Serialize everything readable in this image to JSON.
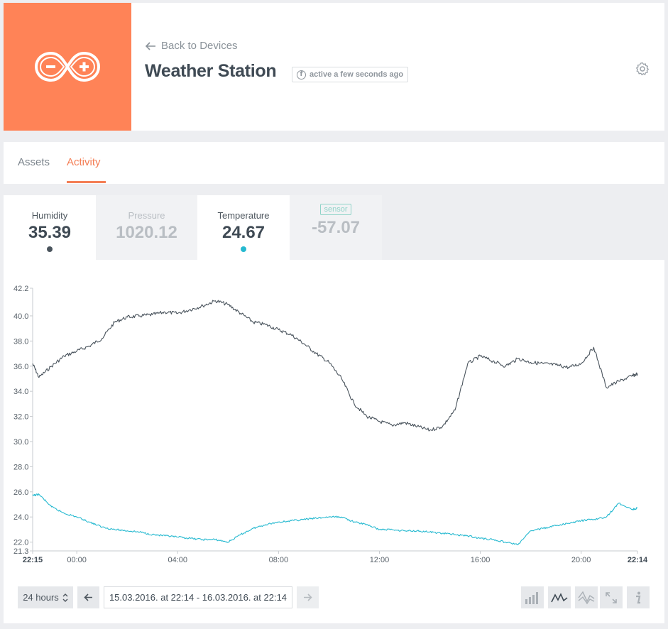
{
  "header": {
    "logo_icon": "arduino-infinity-icon",
    "logo_bg": "#ff8357",
    "back_label": "Back to Devices",
    "title": "Weather Station",
    "status": "active a few seconds ago",
    "status_icon": "f"
  },
  "tabs": [
    {
      "label": "Assets",
      "active": false
    },
    {
      "label": "Activity",
      "active": true
    }
  ],
  "accent": "#f47e55",
  "metrics": [
    {
      "label": "Humidity",
      "value": "35.39",
      "selected": true,
      "color": "#4a545d"
    },
    {
      "label": "Pressure",
      "value": "1020.12",
      "selected": false
    },
    {
      "label": "Temperature",
      "value": "24.67",
      "selected": true,
      "color": "#26b9d0"
    },
    {
      "label": "sensor",
      "value": "-57.07",
      "selected": false
    }
  ],
  "chart_data": {
    "type": "line",
    "y_ticks": [
      "42.2",
      "40.0",
      "38.0",
      "36.0",
      "34.0",
      "32.0",
      "30.0",
      "28.0",
      "26.0",
      "24.0",
      "22.0",
      "21.3"
    ],
    "ylim": [
      21.3,
      42.2
    ],
    "x_ticks": [
      "22:15",
      "00:00",
      "04:00",
      "08:00",
      "12:00",
      "16:00",
      "20:00",
      "22:14"
    ],
    "grid": false,
    "series": [
      {
        "name": "Humidity",
        "color": "#4a545d",
        "x": [
          "22:15",
          "22:30",
          "23:00",
          "23:30",
          "00:00",
          "00:30",
          "01:00",
          "01:30",
          "02:00",
          "02:30",
          "03:00",
          "03:30",
          "04:00",
          "04:30",
          "05:00",
          "05:30",
          "06:00",
          "06:30",
          "07:00",
          "07:30",
          "08:00",
          "08:30",
          "09:00",
          "09:30",
          "10:00",
          "10:30",
          "11:00",
          "11:30",
          "12:00",
          "12:30",
          "13:00",
          "13:30",
          "14:00",
          "14:30",
          "15:00",
          "15:30",
          "16:00",
          "16:30",
          "17:00",
          "17:30",
          "18:00",
          "18:30",
          "19:00",
          "19:30",
          "20:00",
          "20:30",
          "21:00",
          "21:30",
          "22:00",
          "22:14"
        ],
        "values": [
          36.2,
          35.1,
          36.0,
          36.8,
          37.2,
          37.6,
          38.2,
          39.5,
          39.9,
          40.0,
          40.1,
          40.3,
          40.2,
          40.5,
          40.8,
          41.2,
          40.9,
          40.2,
          39.5,
          39.3,
          38.9,
          38.5,
          37.8,
          37.0,
          36.3,
          35.0,
          33.0,
          32.0,
          31.6,
          31.3,
          31.5,
          31.2,
          30.9,
          31.2,
          32.5,
          36.2,
          36.8,
          36.4,
          36.0,
          36.6,
          36.3,
          36.2,
          36.1,
          35.9,
          36.2,
          37.5,
          34.3,
          34.8,
          35.2,
          35.4
        ]
      },
      {
        "name": "Temperature",
        "color": "#26b9d0",
        "x": [
          "22:15",
          "22:30",
          "23:00",
          "23:30",
          "00:00",
          "00:30",
          "01:00",
          "01:30",
          "02:00",
          "02:30",
          "03:00",
          "03:30",
          "04:00",
          "04:30",
          "05:00",
          "05:30",
          "06:00",
          "06:30",
          "07:00",
          "07:30",
          "08:00",
          "08:30",
          "09:00",
          "09:30",
          "10:00",
          "10:30",
          "11:00",
          "11:30",
          "12:00",
          "12:30",
          "13:00",
          "13:30",
          "14:00",
          "14:30",
          "15:00",
          "15:30",
          "16:00",
          "16:30",
          "17:00",
          "17:30",
          "18:00",
          "18:30",
          "19:00",
          "19:30",
          "20:00",
          "20:30",
          "21:00",
          "21:30",
          "22:00",
          "22:14"
        ],
        "values": [
          25.7,
          25.8,
          24.8,
          24.3,
          24.0,
          23.6,
          23.2,
          23.0,
          22.9,
          22.8,
          22.6,
          22.5,
          22.4,
          22.3,
          22.2,
          22.2,
          22.0,
          22.6,
          23.1,
          23.4,
          23.6,
          23.7,
          23.8,
          23.9,
          24.0,
          24.0,
          23.6,
          23.4,
          23.0,
          23.0,
          22.9,
          22.9,
          22.8,
          22.7,
          22.6,
          22.5,
          22.3,
          22.2,
          22.0,
          21.8,
          22.9,
          23.1,
          23.3,
          23.5,
          23.7,
          23.8,
          24.0,
          25.1,
          24.6,
          24.7
        ]
      }
    ]
  },
  "controls": {
    "range_label": "24 hours",
    "range_text": "15.03.2016. at 22:14 - 16.03.2016. at 22:14",
    "viz_icons": [
      "bar-chart-icon",
      "line-chart-icon",
      "area-chart-icon",
      "expand-icon",
      "info-icon"
    ]
  }
}
